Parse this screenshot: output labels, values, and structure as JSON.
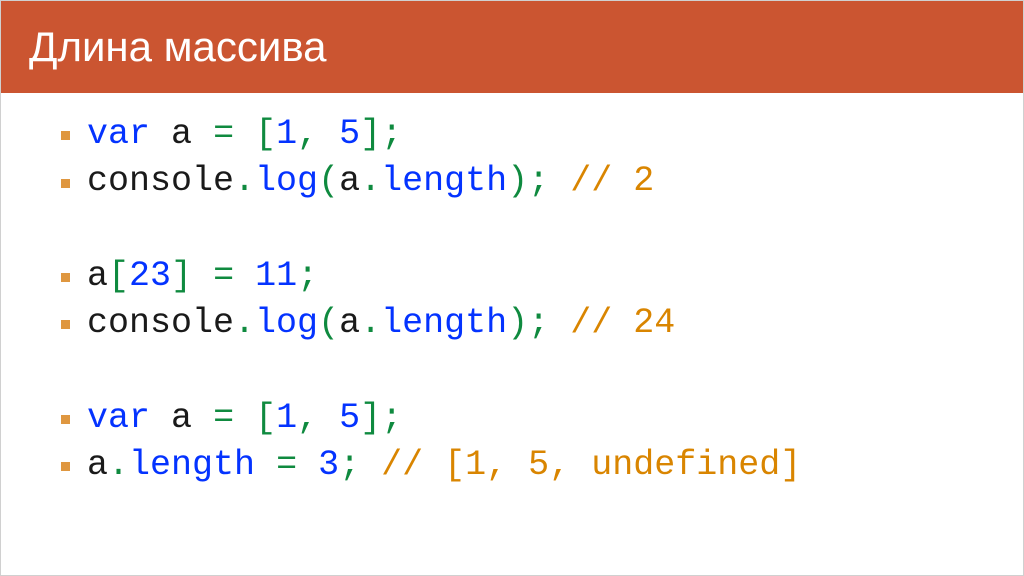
{
  "title": "Длина массива",
  "lines": [
    {
      "blank": false,
      "tokens": [
        {
          "t": "var",
          "c": "kw"
        },
        {
          "t": " ",
          "c": "id"
        },
        {
          "t": "a",
          "c": "id"
        },
        {
          "t": " ",
          "c": "id"
        },
        {
          "t": "=",
          "c": "pun"
        },
        {
          "t": " ",
          "c": "id"
        },
        {
          "t": "[",
          "c": "pun"
        },
        {
          "t": "1",
          "c": "num"
        },
        {
          "t": ",",
          "c": "pun"
        },
        {
          "t": " ",
          "c": "id"
        },
        {
          "t": "5",
          "c": "num"
        },
        {
          "t": "]",
          "c": "pun"
        },
        {
          "t": ";",
          "c": "pun"
        }
      ]
    },
    {
      "blank": false,
      "tokens": [
        {
          "t": "console",
          "c": "obj"
        },
        {
          "t": ".",
          "c": "pun"
        },
        {
          "t": "log",
          "c": "fn"
        },
        {
          "t": "(",
          "c": "pun"
        },
        {
          "t": "a",
          "c": "id"
        },
        {
          "t": ".",
          "c": "pun"
        },
        {
          "t": "length",
          "c": "prop"
        },
        {
          "t": ")",
          "c": "pun"
        },
        {
          "t": ";",
          "c": "pun"
        },
        {
          "t": " ",
          "c": "id"
        },
        {
          "t": "// 2",
          "c": "cmt"
        }
      ]
    },
    {
      "blank": true,
      "tokens": []
    },
    {
      "blank": false,
      "tokens": [
        {
          "t": "a",
          "c": "id"
        },
        {
          "t": "[",
          "c": "pun"
        },
        {
          "t": "23",
          "c": "num"
        },
        {
          "t": "]",
          "c": "pun"
        },
        {
          "t": " ",
          "c": "id"
        },
        {
          "t": "=",
          "c": "pun"
        },
        {
          "t": " ",
          "c": "id"
        },
        {
          "t": "11",
          "c": "num"
        },
        {
          "t": ";",
          "c": "pun"
        }
      ]
    },
    {
      "blank": false,
      "tokens": [
        {
          "t": "console",
          "c": "obj"
        },
        {
          "t": ".",
          "c": "pun"
        },
        {
          "t": "log",
          "c": "fn"
        },
        {
          "t": "(",
          "c": "pun"
        },
        {
          "t": "a",
          "c": "id"
        },
        {
          "t": ".",
          "c": "pun"
        },
        {
          "t": "length",
          "c": "prop"
        },
        {
          "t": ")",
          "c": "pun"
        },
        {
          "t": ";",
          "c": "pun"
        },
        {
          "t": " ",
          "c": "id"
        },
        {
          "t": "// 24",
          "c": "cmt"
        }
      ]
    },
    {
      "blank": true,
      "tokens": []
    },
    {
      "blank": false,
      "tokens": [
        {
          "t": "var",
          "c": "kw"
        },
        {
          "t": " ",
          "c": "id"
        },
        {
          "t": "a",
          "c": "id"
        },
        {
          "t": " ",
          "c": "id"
        },
        {
          "t": "=",
          "c": "pun"
        },
        {
          "t": " ",
          "c": "id"
        },
        {
          "t": "[",
          "c": "pun"
        },
        {
          "t": "1",
          "c": "num"
        },
        {
          "t": ",",
          "c": "pun"
        },
        {
          "t": " ",
          "c": "id"
        },
        {
          "t": "5",
          "c": "num"
        },
        {
          "t": "]",
          "c": "pun"
        },
        {
          "t": ";",
          "c": "pun"
        }
      ]
    },
    {
      "blank": false,
      "tokens": [
        {
          "t": "a",
          "c": "id"
        },
        {
          "t": ".",
          "c": "pun"
        },
        {
          "t": "length",
          "c": "prop"
        },
        {
          "t": " ",
          "c": "id"
        },
        {
          "t": "=",
          "c": "pun"
        },
        {
          "t": " ",
          "c": "id"
        },
        {
          "t": "3",
          "c": "num"
        },
        {
          "t": ";",
          "c": "pun"
        },
        {
          "t": " ",
          "c": "id"
        },
        {
          "t": "// [1, 5, undefined]",
          "c": "cmt"
        }
      ]
    }
  ]
}
